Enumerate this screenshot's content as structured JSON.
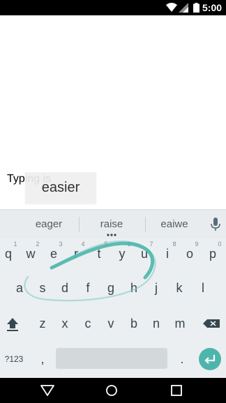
{
  "status_bar": {
    "time": "5:00"
  },
  "content": {
    "typed_text": "Typing is",
    "preview_word": "easier"
  },
  "suggestions": [
    "eager",
    "raise",
    "eaiwe"
  ],
  "keyboard": {
    "row1": [
      {
        "key": "q",
        "hint": "1"
      },
      {
        "key": "w",
        "hint": "2"
      },
      {
        "key": "e",
        "hint": "3"
      },
      {
        "key": "r",
        "hint": "4"
      },
      {
        "key": "t",
        "hint": "5"
      },
      {
        "key": "y",
        "hint": "6"
      },
      {
        "key": "u",
        "hint": "7"
      },
      {
        "key": "i",
        "hint": "8"
      },
      {
        "key": "o",
        "hint": "9"
      },
      {
        "key": "p",
        "hint": "0"
      }
    ],
    "row2": [
      "a",
      "s",
      "d",
      "f",
      "g",
      "h",
      "j",
      "k",
      "l"
    ],
    "row3": [
      "z",
      "x",
      "c",
      "v",
      "b",
      "n",
      "m"
    ],
    "symbols_label": "?123",
    "comma": ",",
    "period": "."
  },
  "colors": {
    "accent": "#4db6ac",
    "gesture_trail": "#80cbc4",
    "key_text": "#37474f",
    "keyboard_bg": "#eceff1"
  },
  "icons": {
    "status": [
      "wifi-icon",
      "signal-icon",
      "battery-icon"
    ],
    "keyboard": [
      "mic-icon",
      "shift-icon",
      "backspace-icon",
      "enter-icon",
      "more-dots-icon"
    ],
    "nav": [
      "back-icon",
      "home-icon",
      "recents-icon"
    ]
  }
}
